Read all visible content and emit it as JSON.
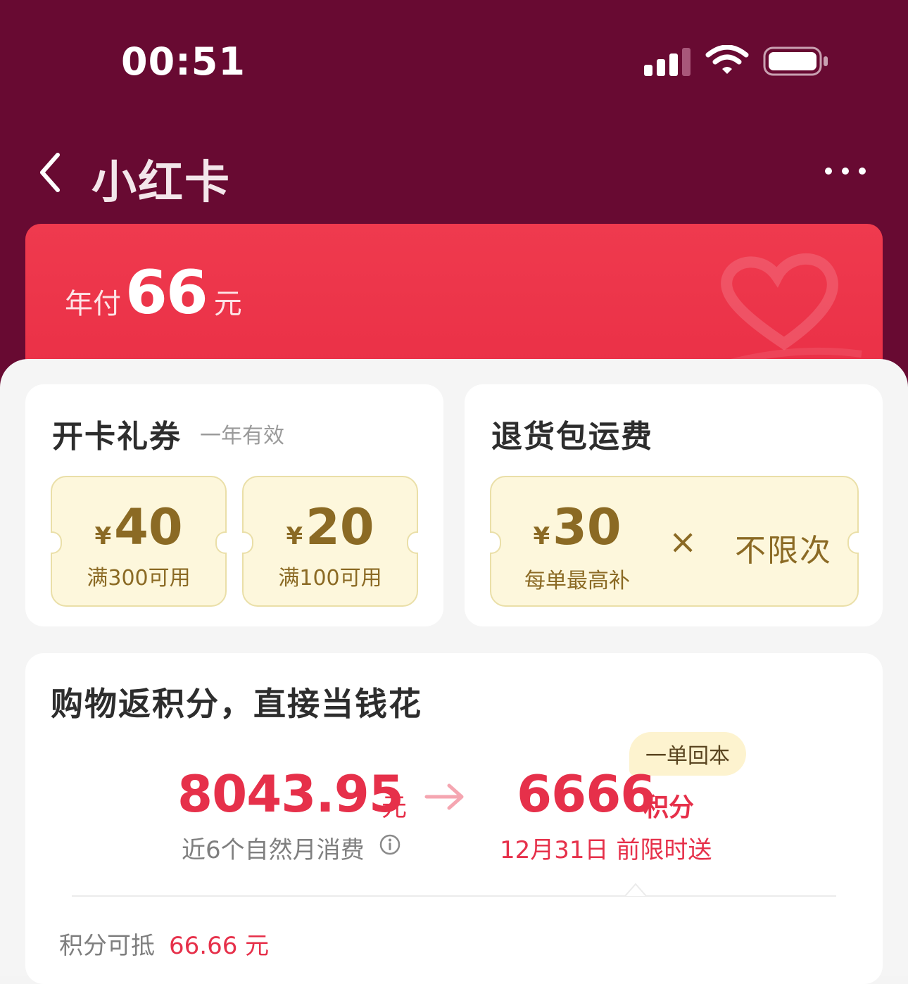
{
  "status_bar": {
    "time": "00:51"
  },
  "nav": {
    "title": "小红卡"
  },
  "membership": {
    "prefix": "年付",
    "price": "66",
    "unit": "元"
  },
  "gift_coupons": {
    "title": "开卡礼券",
    "subtitle": "一年有效",
    "items": [
      {
        "currency": "¥",
        "amount": "40",
        "condition": "满300可用"
      },
      {
        "currency": "¥",
        "amount": "20",
        "condition": "满100可用"
      }
    ]
  },
  "return_shipping": {
    "title": "退货包运费",
    "currency": "¥",
    "amount": "30",
    "caption": "每单最高补",
    "times_symbol": "×",
    "limit": "不限次"
  },
  "points": {
    "title": "购物返积分，直接当钱花",
    "badge": "一单回本",
    "spend_value": "8043.95",
    "spend_unit": "元",
    "spend_label": "近6个自然月消费",
    "points_value": "6666",
    "points_unit": "积分",
    "deadline": "12月31日 前限时送",
    "deduct_label": "积分可抵",
    "deduct_value": "66.66 元"
  },
  "colors": {
    "header_bg": "#680a32",
    "card_red": "#ea3046",
    "accent_red": "#e6304a",
    "coupon_bg": "#fdf7dc",
    "coupon_text": "#8b6a24"
  },
  "icons": [
    "signal-icon",
    "wifi-icon",
    "battery-icon",
    "back-icon",
    "more-icon",
    "heart-icon",
    "arrow-right-icon",
    "info-icon"
  ]
}
